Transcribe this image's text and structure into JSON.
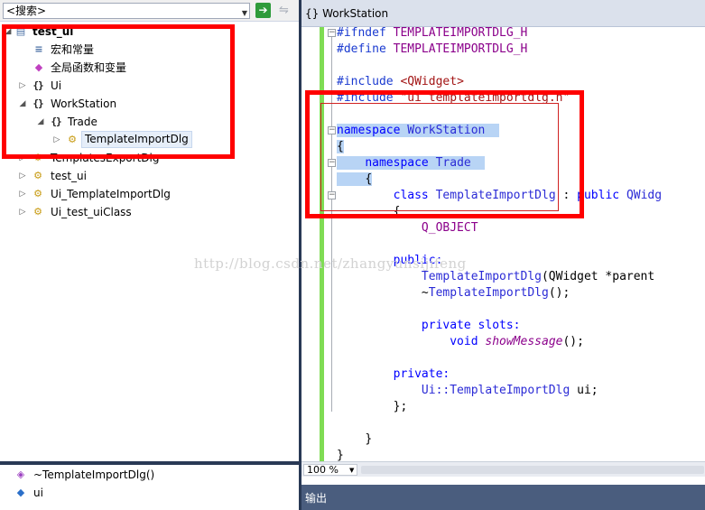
{
  "search": {
    "value": "<搜索>",
    "go_icon": "green-arrow-go-icon",
    "clear_icon": "clear-icon"
  },
  "class_view": {
    "project": "test_ui",
    "items": [
      {
        "label": "宏和常量",
        "icon": "macros-icon"
      },
      {
        "label": "全局函数和变量",
        "icon": "global-functions-icon"
      },
      {
        "label": "Ui",
        "icon": "namespace-icon"
      },
      {
        "label": "WorkStation",
        "icon": "namespace-icon"
      },
      {
        "label": "Trade",
        "icon": "namespace-icon"
      },
      {
        "label": "TemplateImportDlg",
        "icon": "class-icon"
      },
      {
        "label": "TemplatesExportDlg",
        "icon": "class-icon"
      },
      {
        "label": "test_ui",
        "icon": "class-icon"
      },
      {
        "label": "Ui_TemplateImportDlg",
        "icon": "class-icon"
      },
      {
        "label": "Ui_test_uiClass",
        "icon": "class-icon"
      }
    ]
  },
  "members": [
    {
      "label": "~TemplateImportDlg()",
      "icon": "method-icon"
    },
    {
      "label": "ui",
      "icon": "field-icon"
    }
  ],
  "editor": {
    "tab_title": "{} WorkStation",
    "zoom": "100 %",
    "lines": {
      "l1a": "#ifndef",
      "l1b": "TEMPLATEIMPORTDLG_H",
      "l2a": "#define",
      "l2b": "TEMPLATEIMPORTDLG_H",
      "l3a": "#include",
      "l3b": "<QWidget>",
      "l4a": "#include",
      "l4b": "\"ui_templateimportdlg.h\"",
      "l5a": "namespace",
      "l5b": "WorkStation",
      "l6": "{",
      "l7a": "namespace",
      "l7b": "Trade",
      "l8": "{",
      "l9a": "class",
      "l9b": "TemplateImportDlg",
      "l9c": ":",
      "l9d": "public",
      "l9e": "QWidg",
      "l10": "{",
      "l11": "Q_OBJECT",
      "l12": "public:",
      "l13a": "TemplateImportDlg",
      "l13b": "(QWidget *parent",
      "l14a": "~",
      "l14b": "TemplateImportDlg",
      "l14c": "();",
      "l15a": "private",
      "l15b": "slots:",
      "l16a": "void",
      "l16b": "showMessage",
      "l16c": "();",
      "l17": "private:",
      "l18a": "Ui::",
      "l18b": "TemplateImportDlg",
      "l18c": "ui;",
      "l19": "};",
      "l20": "}",
      "l21": "}"
    }
  },
  "output_title": "输出",
  "watermark": "http://blog.csdn.net/zhangyunsijifeng",
  "colors": {
    "annotation_red": "#ff0000",
    "change_bar_green": "#7fdc54",
    "keyword_blue": "#0000ff"
  }
}
